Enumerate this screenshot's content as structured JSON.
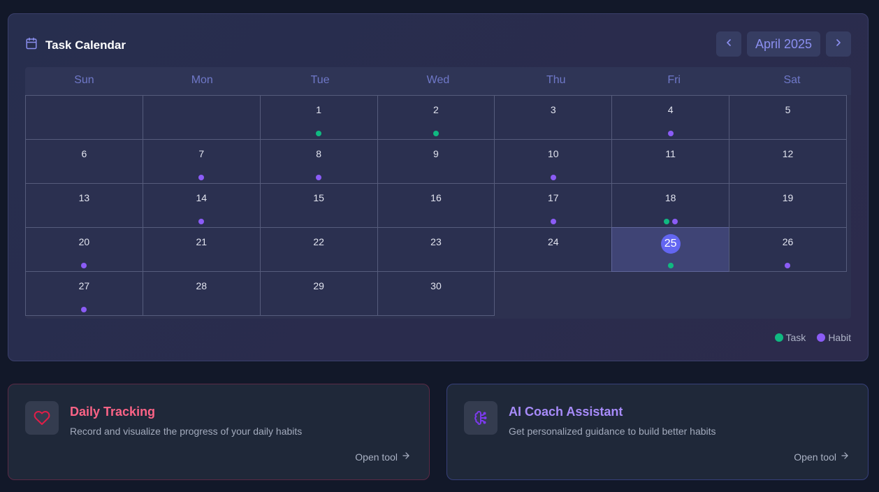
{
  "calendar": {
    "title": "Task Calendar",
    "month": "April 2025",
    "weekdays": [
      "Sun",
      "Mon",
      "Tue",
      "Wed",
      "Thu",
      "Fri",
      "Sat"
    ],
    "leading_blanks": 2,
    "today": 25,
    "days": [
      {
        "day": "1",
        "markers": [
          "task"
        ]
      },
      {
        "day": "2",
        "markers": [
          "task"
        ]
      },
      {
        "day": "3",
        "markers": []
      },
      {
        "day": "4",
        "markers": [
          "habit"
        ]
      },
      {
        "day": "5",
        "markers": []
      },
      {
        "day": "6",
        "markers": []
      },
      {
        "day": "7",
        "markers": [
          "habit"
        ]
      },
      {
        "day": "8",
        "markers": [
          "habit"
        ]
      },
      {
        "day": "9",
        "markers": []
      },
      {
        "day": "10",
        "markers": [
          "habit"
        ]
      },
      {
        "day": "11",
        "markers": []
      },
      {
        "day": "12",
        "markers": []
      },
      {
        "day": "13",
        "markers": []
      },
      {
        "day": "14",
        "markers": [
          "habit"
        ]
      },
      {
        "day": "15",
        "markers": []
      },
      {
        "day": "16",
        "markers": []
      },
      {
        "day": "17",
        "markers": [
          "habit"
        ]
      },
      {
        "day": "18",
        "markers": [
          "task",
          "habit"
        ]
      },
      {
        "day": "19",
        "markers": []
      },
      {
        "day": "20",
        "markers": [
          "habit"
        ]
      },
      {
        "day": "21",
        "markers": []
      },
      {
        "day": "22",
        "markers": []
      },
      {
        "day": "23",
        "markers": []
      },
      {
        "day": "24",
        "markers": []
      },
      {
        "day": "25",
        "markers": [
          "task"
        ]
      },
      {
        "day": "26",
        "markers": [
          "habit"
        ]
      },
      {
        "day": "27",
        "markers": [
          "habit"
        ]
      },
      {
        "day": "28",
        "markers": []
      },
      {
        "day": "29",
        "markers": []
      },
      {
        "day": "30",
        "markers": []
      }
    ],
    "legend": {
      "task": "Task",
      "habit": "Habit"
    },
    "colors": {
      "task": "#10b981",
      "habit": "#8b5cf6",
      "today": "#6366f1",
      "accent": "#8b8ff0"
    },
    "icons": {
      "title": "calendar-icon",
      "prev": "chevron-left-icon",
      "next": "chevron-right-icon"
    }
  },
  "tools": [
    {
      "title": "Daily Tracking",
      "description": "Record and visualize the progress of your daily habits",
      "link": "Open tool",
      "icon": "heart-icon",
      "color": "#fb6386"
    },
    {
      "title": "AI Coach Assistant",
      "description": "Get personalized guidance to build better habits",
      "link": "Open tool",
      "icon": "brain-icon",
      "color": "#a78bfa"
    }
  ]
}
